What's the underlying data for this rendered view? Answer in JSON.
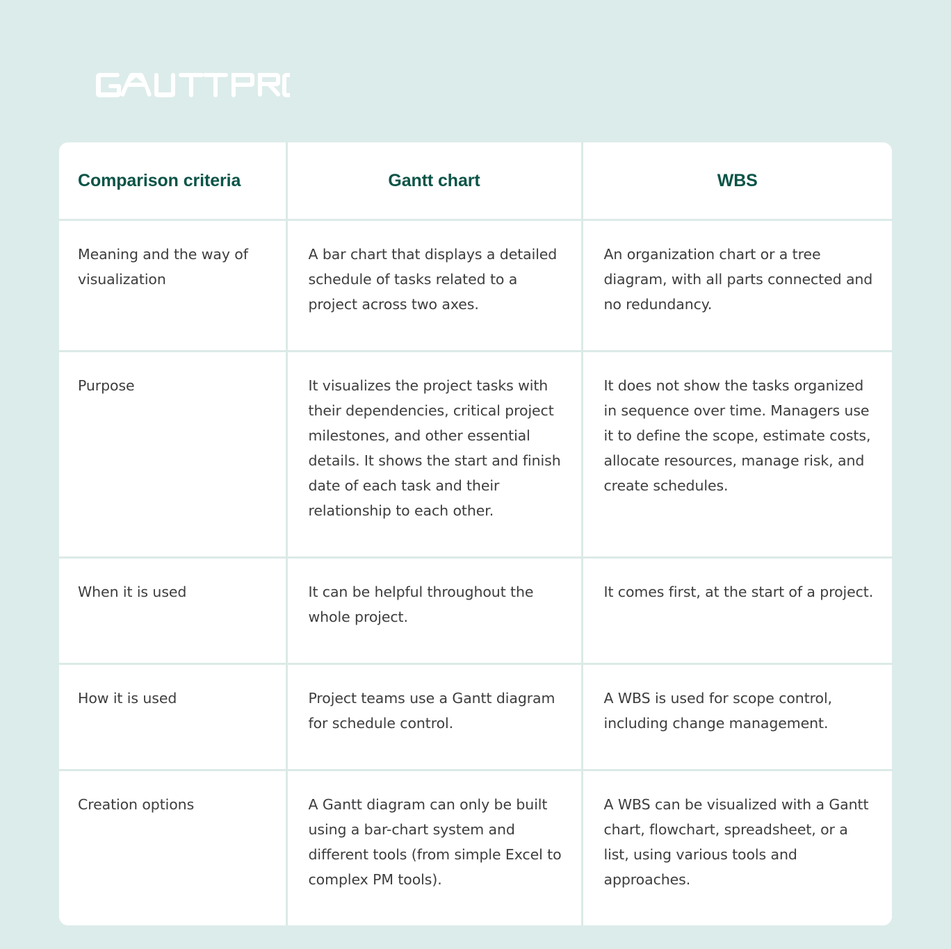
{
  "brand": {
    "logo_text": "GANTTPRO",
    "logo_color": "#ffffff"
  },
  "theme": {
    "page_background": "#dcecea",
    "card_background": "#ffffff",
    "divider_color": "#dbeae7",
    "header_text_color": "#0b5447",
    "body_text_color": "#3d3d3f"
  },
  "table": {
    "headers": [
      "Comparison criteria",
      "Gantt chart",
      "WBS"
    ],
    "rows": [
      {
        "criteria": "Meaning and the way of visualization",
        "gantt": "A bar chart that displays a detailed schedule of tasks related to a project across two axes.",
        "wbs": "An organization chart or a tree diagram, with all parts connected and no redundancy."
      },
      {
        "criteria": "Purpose",
        "gantt": "It visualizes the project tasks with their dependencies, critical project milestones, and other essential details. It shows the start and finish date of each task and their relationship to each other.",
        "wbs": "It does not show the tasks organized in sequence over time. Managers use it to define the scope, estimate costs, allocate resources, manage risk, and create schedules."
      },
      {
        "criteria": "When it is used",
        "gantt": "It can be helpful throughout the whole project.",
        "wbs": "It comes first, at the start of a project."
      },
      {
        "criteria": "How it is used",
        "gantt": "Project teams use a Gantt diagram for schedule control.",
        "wbs": "A WBS is used for scope control, including change management."
      },
      {
        "criteria": "Creation options",
        "gantt": "A Gantt diagram can only be built using a bar-chart system and different tools (from simple Excel to complex PM tools).",
        "wbs": "A WBS can be visualized with a Gantt chart, flowchart, spreadsheet, or a list, using various tools and approaches."
      }
    ]
  }
}
